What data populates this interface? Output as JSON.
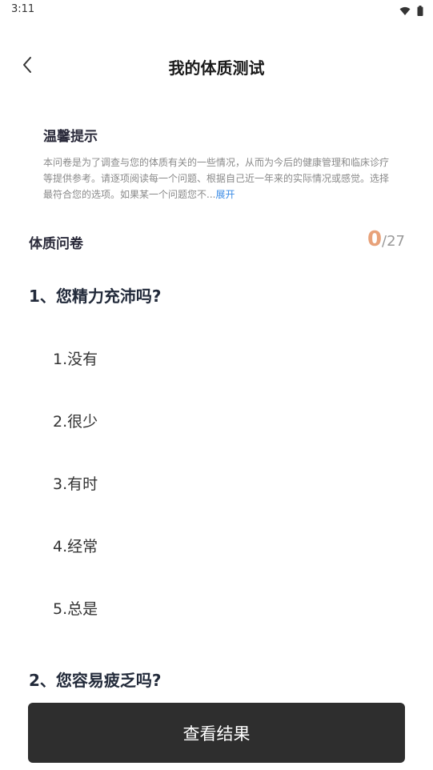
{
  "status_bar": {
    "time": "3:11",
    "icons": [
      "wifi-icon",
      "battery-icon"
    ]
  },
  "header": {
    "title": "我的体质测试",
    "back_icon": "back-arrow-icon"
  },
  "tips": {
    "title": "温馨提示",
    "body": "本问卷是为了调查与您的体质有关的一些情况，从而为今后的健康管理和临床诊疗等提供参考。请逐项阅读每一个问题、根据自己近一年来的实际情况或感觉。选择最符合您的选项。如果某一个问题您不...",
    "expand_label": "展开"
  },
  "questionnaire": {
    "label": "体质问卷",
    "answered": "0",
    "total": "/27"
  },
  "questions": [
    {
      "title": "1、您精力充沛吗?",
      "options": [
        "1.没有",
        "2.很少",
        "3.有时",
        "4.经常",
        "5.总是"
      ]
    },
    {
      "title": "2、您容易疲乏吗?"
    }
  ],
  "footer": {
    "button_label": "查看结果"
  },
  "colors": {
    "accent_count": "#e8a27a",
    "link": "#3a8be6",
    "button_bg": "#2e2e2e"
  }
}
